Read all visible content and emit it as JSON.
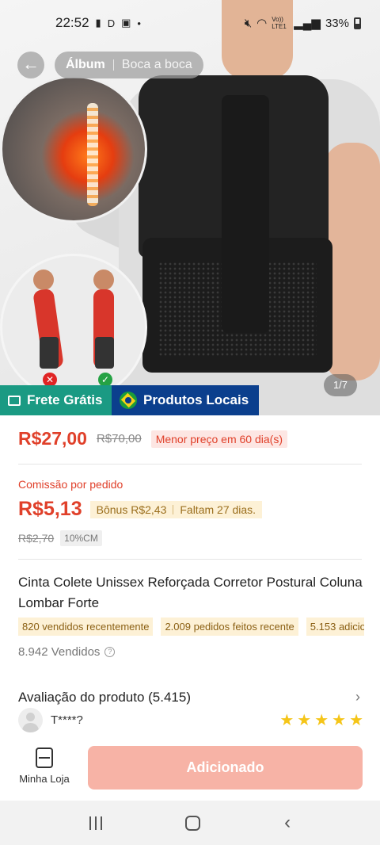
{
  "status_bar": {
    "time": "22:52",
    "battery": "33%",
    "network": "Vo)) LTE1"
  },
  "gallery": {
    "tabs": [
      "Álbum",
      "Boca a boca"
    ],
    "counter": "1/7"
  },
  "badges": {
    "frete": "Frete Grátis",
    "local": "Produtos Locais"
  },
  "price": {
    "current": "R$27,00",
    "original": "R$70,00",
    "lowest_tag": "Menor preço em 60 dia(s)"
  },
  "commission": {
    "label": "Comissão por pedido",
    "amount": "R$5,13",
    "bonus": "Bônus R$2,43",
    "remaining": "Faltam 27 dias.",
    "original": "R$2,70",
    "rate": "10%CM"
  },
  "product": {
    "title": "Cinta Colete Unissex Reforçada Corretor Postural Coluna Lombar Forte",
    "tags": [
      "820 vendidos recentemente",
      "2.009 pedidos feitos recente",
      "5.153 adicio"
    ],
    "sold": "8.942 Vendidos"
  },
  "review": {
    "title": "Avaliação do produto (5.415)",
    "reviewer": "T****?",
    "stars": [
      "★",
      "★",
      "★",
      "★",
      "★"
    ]
  },
  "action_bar": {
    "store_label": "Minha Loja",
    "add_button": "Adicionado"
  },
  "colors": {
    "price_red": "#e0402a",
    "frete_green": "#1a9a83",
    "local_blue": "#0b3f8d",
    "button_disabled": "#f7b3a6"
  }
}
